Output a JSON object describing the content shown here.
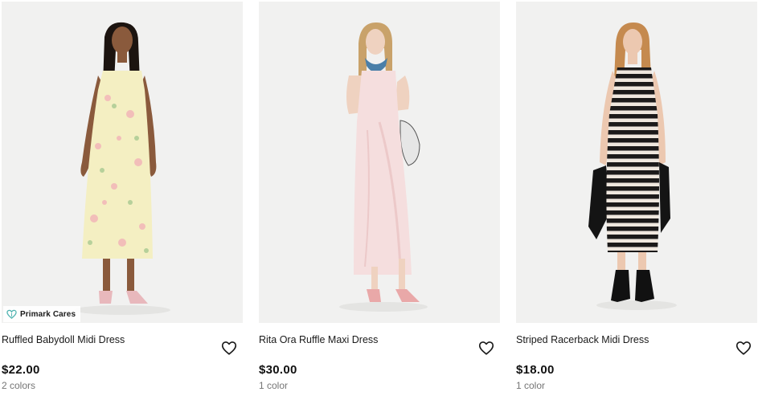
{
  "products": [
    {
      "name": "Ruffled Babydoll Midi Dress",
      "price": "$22.00",
      "colors": "2 colors",
      "badge": "Primark Cares",
      "image": "woman-yellow-floral-dress"
    },
    {
      "name": "Rita Ora Ruffle Maxi Dress",
      "price": "$30.00",
      "colors": "1 color",
      "image": "woman-pink-ruffle-maxi-dress"
    },
    {
      "name": "Striped Racerback Midi Dress",
      "price": "$18.00",
      "colors": "1 color",
      "image": "woman-black-white-striped-dress"
    }
  ],
  "icons": {
    "wishlist": "heart-outline-icon",
    "badge": "heart-leaf-icon"
  },
  "colors": {
    "image_bg": "#f0f0ef",
    "price": "#111111",
    "muted": "#757575",
    "badge_icon": "#4fb3b0"
  }
}
